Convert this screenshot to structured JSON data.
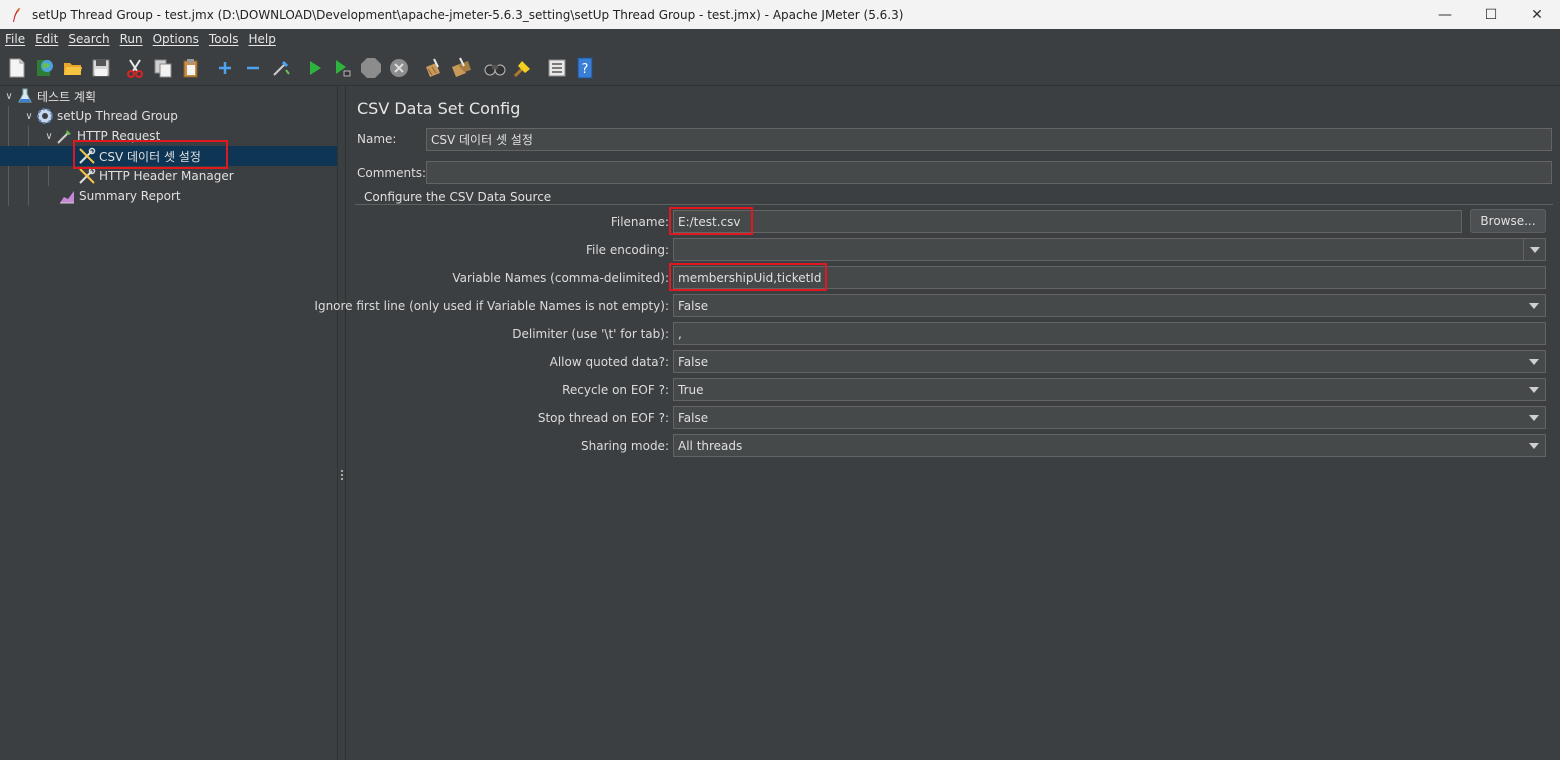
{
  "window": {
    "title": "setUp Thread Group - test.jmx (D:\\DOWNLOAD\\Development\\apache-jmeter-5.6.3_setting\\setUp Thread Group - test.jmx) - Apache JMeter (5.6.3)",
    "minimize_glyph": "—",
    "maximize_glyph": "☐",
    "close_glyph": "✕"
  },
  "menu": {
    "items": [
      "File",
      "Edit",
      "Search",
      "Run",
      "Options",
      "Tools",
      "Help"
    ]
  },
  "toolbar": {
    "icons": [
      "new-icon",
      "templates-icon",
      "open-icon",
      "save-icon",
      "cut-icon",
      "copy-icon",
      "paste-icon",
      "expand-icon",
      "collapse-icon",
      "toggle-icon",
      "start-icon",
      "start-no-pause-icon",
      "stop-icon",
      "shutdown-icon",
      "clear-icon",
      "clear-all-icon",
      "search-icon",
      "reset-search-icon",
      "function-helper-icon",
      "help-icon"
    ]
  },
  "tree": {
    "items": [
      {
        "label": "테스트 계획",
        "icon": "test-plan-icon"
      },
      {
        "label": "setUp Thread Group",
        "icon": "thread-group-gear-icon"
      },
      {
        "label": "HTTP Request",
        "icon": "sampler-pipette-icon"
      },
      {
        "label": "CSV 데이터 셋 설정",
        "icon": "config-wrench-icon"
      },
      {
        "label": "HTTP Header Manager",
        "icon": "config-wrench-icon"
      },
      {
        "label": "Summary Report",
        "icon": "listener-chart-icon"
      }
    ]
  },
  "panel": {
    "title": "CSV Data Set Config",
    "name_label": "Name:",
    "name_value": "CSV 데이터 셋 설정",
    "comments_label": "Comments:",
    "comments_value": "",
    "group_title": "Configure the CSV Data Source",
    "filename_label": "Filename:",
    "filename_value": "E:/test.csv",
    "browse_label": "Browse...",
    "encoding_label": "File encoding:",
    "encoding_value": "",
    "varnames_label": "Variable Names (comma-delimited):",
    "varnames_value": "membershipUid,ticketId",
    "ignore_label": "Ignore first line (only used if Variable Names is not empty):",
    "ignore_value": "False",
    "delimiter_label": "Delimiter (use '\\t' for tab):",
    "delimiter_value": ",",
    "quoted_label": "Allow quoted data?:",
    "quoted_value": "False",
    "recycle_label": "Recycle on EOF ?:",
    "recycle_value": "True",
    "stopthread_label": "Stop thread on EOF ?:",
    "stopthread_value": "False",
    "sharing_label": "Sharing mode:",
    "sharing_value": "All threads"
  },
  "colors": {
    "background": "#3c3f41",
    "input_bg": "#45494a",
    "selection": "#0e3553",
    "highlight": "#e0181f"
  }
}
